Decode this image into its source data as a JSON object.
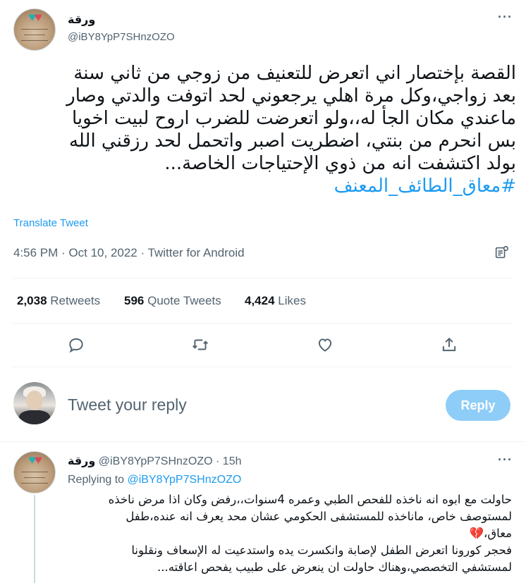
{
  "tweet": {
    "author_name": "ورقة",
    "author_handle": "@iBY8YpP7SHnzOZO",
    "text_lines": [
      "القصة بإختصار اني اتعرض للتعنيف من زوجي من ثاني سنة",
      "بعد زواجي،وكل مرة اهلي يرجعوني لحد اتوفت والدتي وصار",
      "ماعندي مكان الجأ له،،ولو اتعرضت للضرب اروح لبيت اخويا",
      "بس انحرم من بنتي، اضطريت اصبر واتحمل لحد رزقني الله",
      "بولد اكتشفت انه من ذوي الإحتياجات الخاصة..."
    ],
    "hashtag": "#معاق_الطائف_المعنف",
    "translate_label": "Translate Tweet",
    "timestamp": "4:56 PM · Oct 10, 2022 · Twitter for Android",
    "retweets_count": "2,038",
    "retweets_label": "Retweets",
    "quote_count": "596",
    "quote_label": "Quote Tweets",
    "likes_count": "4,424",
    "likes_label": "Likes"
  },
  "icons": [
    "analytics-icon",
    "reply-icon",
    "retweet-icon",
    "like-icon",
    "share-icon",
    "more-icon",
    "broken-heart-icon"
  ],
  "reply_box": {
    "placeholder": "Tweet your reply",
    "button_label": "Reply"
  },
  "reply_tweet": {
    "author_name": "ورقة",
    "author_handle": "@iBY8YpP7SHnzOZO",
    "time": "· 15h",
    "replying_label": "Replying to",
    "replying_handle": "@iBY8YpP7SHnzOZO",
    "text_lines": [
      "حاولت مع ابوه انه ناخذه للفحص الطبي وعمره 4سنوات،،رفض وكان اذا مرض ناخذه",
      "لمستوصف خاص، ماناخذه للمستشفى الحكومي عشان محد يعرف انه عنده،طفل",
      "معاق،",
      "فحجر كورونا اتعرض الطفل لإصابة وانكسرت يده واستدعيت له الإسعاف ونقلونا",
      "لمستشفي التخصصي،وهناك حاولت ان ينعرض على طبيب يفحص اعاقته..."
    ]
  },
  "colors": {
    "accent": "#1d9bf0",
    "text": "#0f1419",
    "muted": "#536471",
    "reply_button": "#8ecdf7",
    "divider": "#eff3f4"
  }
}
